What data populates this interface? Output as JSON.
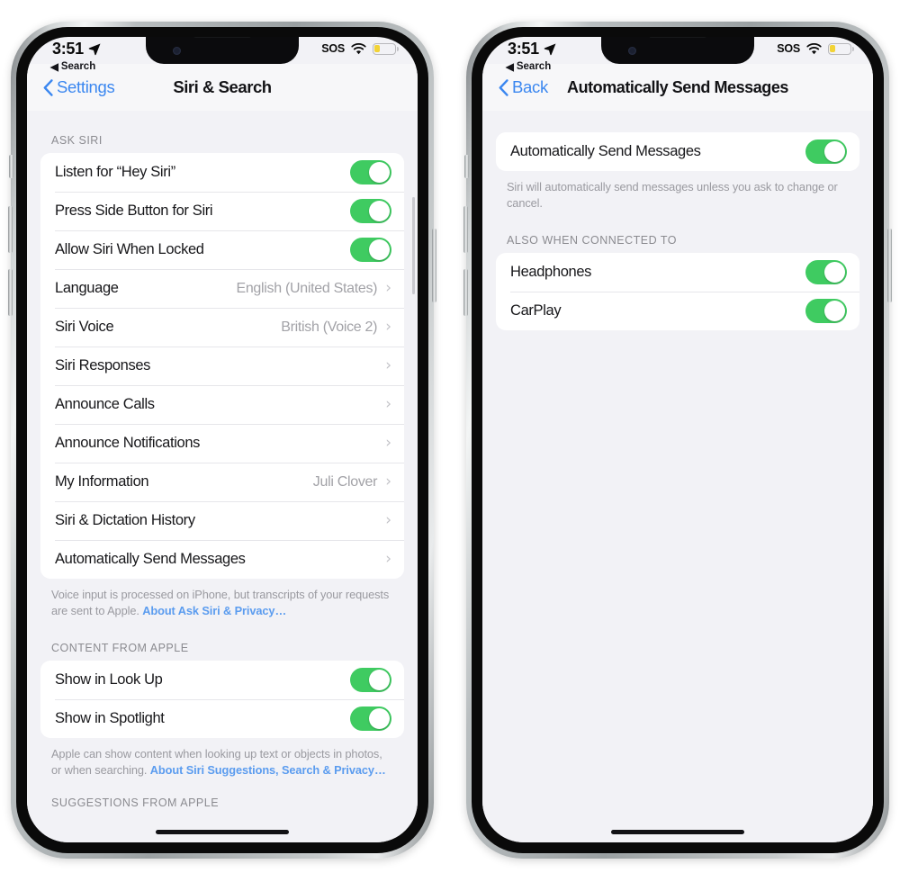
{
  "page": {
    "background": "#ffffff",
    "accent_blue": "#3b87f0",
    "toggle_green": "#3fcb61",
    "screen_background": "#f2f2f6"
  },
  "phones": [
    {
      "id": "left",
      "status_bar": {
        "time": "3:51",
        "location_icon": "location-arrow-icon",
        "sos_label": "SOS",
        "wifi_icon": "wifi-icon",
        "battery_icon": "battery-low-icon"
      },
      "app_backlink": {
        "arrow": "◀",
        "label": "Search"
      },
      "navbar": {
        "back_label": "Settings",
        "back_chevron": "‹",
        "title": "Siri & Search"
      },
      "sections": [
        {
          "header": "ASK SIRI",
          "rows": [
            {
              "label": "Listen for “Hey Siri”",
              "type": "toggle",
              "value": "on"
            },
            {
              "label": "Press Side Button for Siri",
              "type": "toggle",
              "value": "on"
            },
            {
              "label": "Allow Siri When Locked",
              "type": "toggle",
              "value": "on"
            },
            {
              "label": "Language",
              "type": "disclosure",
              "value": "English (United States)"
            },
            {
              "label": "Siri Voice",
              "type": "disclosure",
              "value": "British (Voice 2)"
            },
            {
              "label": "Siri Responses",
              "type": "disclosure",
              "value": ""
            },
            {
              "label": "Announce Calls",
              "type": "disclosure",
              "value": ""
            },
            {
              "label": "Announce Notifications",
              "type": "disclosure",
              "value": ""
            },
            {
              "label": "My Information",
              "type": "disclosure",
              "value": "Juli Clover"
            },
            {
              "label": "Siri & Dictation History",
              "type": "disclosure",
              "value": ""
            },
            {
              "label": "Automatically Send Messages",
              "type": "disclosure",
              "value": ""
            }
          ],
          "footnote_text": "Voice input is processed on iPhone, but transcripts of your requests are sent to Apple. ",
          "footnote_link": "About Ask Siri & Privacy…"
        },
        {
          "header": "CONTENT FROM APPLE",
          "rows": [
            {
              "label": "Show in Look Up",
              "type": "toggle",
              "value": "on"
            },
            {
              "label": "Show in Spotlight",
              "type": "toggle",
              "value": "on"
            }
          ],
          "footnote_text": "Apple can show content when looking up text or objects in photos, or when searching. ",
          "footnote_link": "About Siri Suggestions, Search & Privacy…"
        },
        {
          "header": "SUGGESTIONS FROM APPLE",
          "rows": [],
          "footnote_text": "",
          "footnote_link": ""
        }
      ]
    },
    {
      "id": "right",
      "status_bar": {
        "time": "3:51",
        "location_icon": "location-arrow-icon",
        "sos_label": "SOS",
        "wifi_icon": "wifi-icon",
        "battery_icon": "battery-low-icon"
      },
      "app_backlink": {
        "arrow": "◀",
        "label": "Search"
      },
      "navbar": {
        "back_label": "Back",
        "back_chevron": "‹",
        "title": "Automatically Send Messages"
      },
      "sections": [
        {
          "header": "",
          "rows": [
            {
              "label": "Automatically Send Messages",
              "type": "toggle",
              "value": "on"
            }
          ],
          "footnote_text": "Siri will automatically send messages unless you ask to change or cancel.",
          "footnote_link": ""
        },
        {
          "header": "ALSO WHEN CONNECTED TO",
          "rows": [
            {
              "label": "Headphones",
              "type": "toggle",
              "value": "on"
            },
            {
              "label": "CarPlay",
              "type": "toggle",
              "value": "on"
            }
          ],
          "footnote_text": "",
          "footnote_link": ""
        }
      ]
    }
  ]
}
